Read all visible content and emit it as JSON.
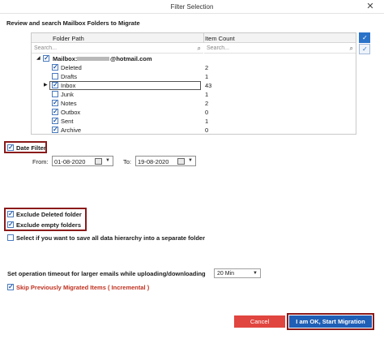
{
  "window": {
    "title": "Filter Selection",
    "close_glyph": "✕"
  },
  "heading": "Review and search Mailbox Folders to Migrate",
  "grid": {
    "col_folder": "Folder Path",
    "col_count": "Item Count",
    "search_placeholder": "Search...",
    "mailbox_label": "Mailbox:",
    "mailbox_email": "@hotmail.com",
    "rows": [
      {
        "name": "Deleted",
        "count": "2",
        "checked": true
      },
      {
        "name": "Drafts",
        "count": "1",
        "checked": false
      },
      {
        "name": "Inbox",
        "count": "43",
        "checked": true
      },
      {
        "name": "Junk",
        "count": "1",
        "checked": false
      },
      {
        "name": "Notes",
        "count": "2",
        "checked": true
      },
      {
        "name": "Outbox",
        "count": "0",
        "checked": true
      },
      {
        "name": "Sent",
        "count": "1",
        "checked": true
      },
      {
        "name": "Archive",
        "count": "0",
        "checked": true
      }
    ]
  },
  "date_filter": {
    "label": "Date Filter",
    "from_label": "From:",
    "from_value": "01-08-2020",
    "to_label": "To:",
    "to_value": "19-08-2020"
  },
  "options": {
    "exclude_deleted": "Exclude Deleted folder",
    "exclude_empty": "Exclude empty folders",
    "separate_folder": "Select if you want to save all data hierarchy into a separate folder"
  },
  "timeout": {
    "label": "Set operation timeout for larger emails while uploading/downloading",
    "value": "20 Min"
  },
  "skip_migrated": "Skip Previously Migrated Items ( Incremental )",
  "buttons": {
    "cancel": "Cancel",
    "start": "I am OK, Start Migration"
  },
  "colors": {
    "accent": "#1f5fb6",
    "cancel": "#e0453f",
    "highlight": "#8b1a1a",
    "link_red": "#c0301f"
  }
}
